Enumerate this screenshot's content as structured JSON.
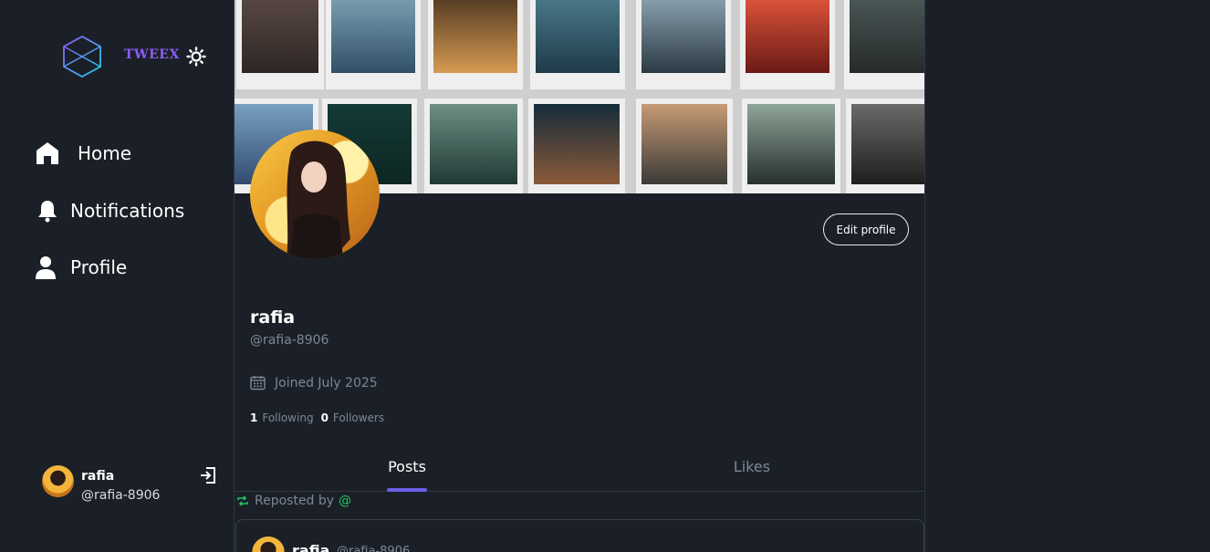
{
  "brand": {
    "name": "TWEEX",
    "accent": "#8b5cf6"
  },
  "sidebar": {
    "items": [
      {
        "label": "Home",
        "icon": "home-icon"
      },
      {
        "label": "Notifications",
        "icon": "bell-icon"
      },
      {
        "label": "Profile",
        "icon": "user-icon"
      }
    ],
    "account": {
      "name": "rafia",
      "handle": "@rafia-8906"
    }
  },
  "profile": {
    "name": "rafia",
    "handle": "@rafia-8906",
    "edit_label": "Edit profile",
    "joined": "Joined July 2025",
    "following_count": "1",
    "following_label": "Following",
    "followers_count": "0",
    "followers_label": "Followers"
  },
  "tabs": [
    {
      "label": "Posts",
      "active": true
    },
    {
      "label": "Likes",
      "active": false
    }
  ],
  "feed": {
    "repost_label": "Reposted by",
    "repost_user": "@",
    "post": {
      "name": "rafia",
      "handle": "@rafia-8906"
    }
  },
  "colors": {
    "background": "#1b2028",
    "tab_indicator": "#6d5ee8",
    "repost": "#22c55e"
  }
}
